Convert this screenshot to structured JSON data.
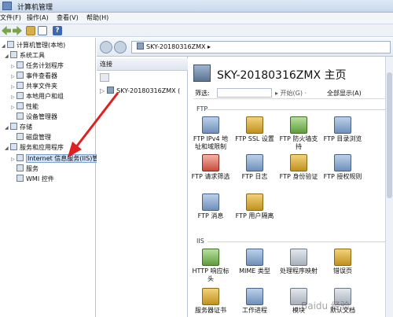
{
  "window": {
    "title": "计算机管理"
  },
  "menu": {
    "file": "文件(F)",
    "action": "操作(A)",
    "view": "查看(V)",
    "help": "帮助(H)"
  },
  "toolbar": {
    "help_label": "?"
  },
  "tree": {
    "items": [
      {
        "label": "计算机管理(本地)"
      },
      {
        "label": "系统工具"
      },
      {
        "label": "任务计划程序"
      },
      {
        "label": "事件查看器"
      },
      {
        "label": "共享文件夹"
      },
      {
        "label": "本地用户和组"
      },
      {
        "label": "性能"
      },
      {
        "label": "设备管理器"
      },
      {
        "label": "存储"
      },
      {
        "label": "磁盘管理"
      },
      {
        "label": "服务和应用程序"
      },
      {
        "label": "Internet 信息服务(IIS)管"
      },
      {
        "label": "服务"
      },
      {
        "label": "WMI 控件"
      }
    ]
  },
  "address": {
    "path": "SKY-20180316ZMX ▸"
  },
  "connections": {
    "header": "连接",
    "node": "SKY-20180316ZMX ("
  },
  "main": {
    "title": "SKY-20180316ZMX 主页",
    "filter_label": "筛选:",
    "go_label": "▸ 开始(G) ·",
    "show_all_label": "全部显示(A)",
    "section_ftp": "FTP",
    "section_iis": "IIS",
    "ftp_features": [
      {
        "label": "FTP IPv4 地址和域限制",
        "icon": "ftp-ipv4-icon",
        "color": "blue"
      },
      {
        "label": "FTP SSL 设置",
        "icon": "lock-icon",
        "color": "gold"
      },
      {
        "label": "FTP 防火墙支持",
        "icon": "firewall-icon",
        "color": "green"
      },
      {
        "label": "FTP 目录浏览",
        "icon": "directory-icon",
        "color": "blue"
      },
      {
        "label": "FTP 请求筛选",
        "icon": "filter-icon",
        "color": "red"
      },
      {
        "label": "FTP 日志",
        "icon": "log-icon",
        "color": "blue"
      },
      {
        "label": "FTP 身份验证",
        "icon": "auth-icon",
        "color": "gold"
      },
      {
        "label": "FTP 授权规则",
        "icon": "authz-icon",
        "color": "blue"
      },
      {
        "label": "FTP 消息",
        "icon": "message-icon",
        "color": "blue"
      },
      {
        "label": "FTP 用户隔离",
        "icon": "user-isolation-icon",
        "color": "gold"
      }
    ],
    "iis_features": [
      {
        "label": "HTTP 响应标头",
        "icon": "http-header-icon",
        "color": "green"
      },
      {
        "label": "MIME 类型",
        "icon": "mime-icon",
        "color": "blue"
      },
      {
        "label": "处理程序映射",
        "icon": "handler-icon",
        "color": "grey"
      },
      {
        "label": "错误页",
        "icon": "error-page-icon",
        "color": "gold"
      },
      {
        "label": "服务器证书",
        "icon": "certificate-icon",
        "color": "gold"
      },
      {
        "label": "工作进程",
        "icon": "worker-process-icon",
        "color": "blue"
      },
      {
        "label": "模块",
        "icon": "module-icon",
        "color": "grey"
      },
      {
        "label": "默认文档",
        "icon": "default-doc-icon",
        "color": "grey"
      }
    ]
  },
  "watermark": "Baidu 经验"
}
